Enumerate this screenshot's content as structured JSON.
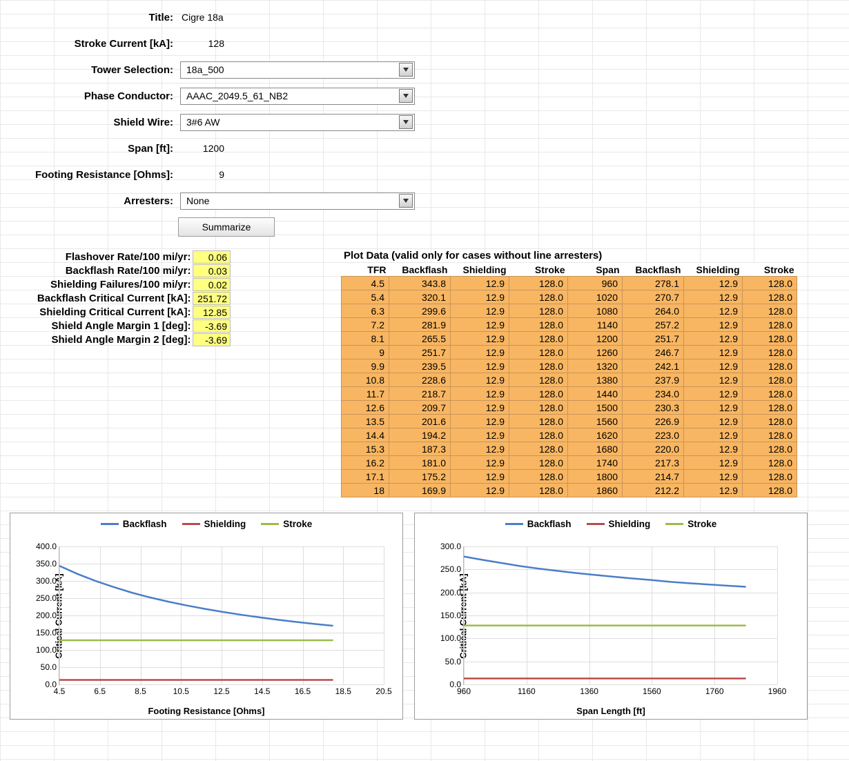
{
  "form": {
    "title_label": "Title:",
    "title_value": "Cigre 18a",
    "stroke_current_label": "Stroke Current [kA]:",
    "stroke_current_value": "128",
    "tower_label": "Tower Selection:",
    "tower_value": "18a_500",
    "phase_label": "Phase Conductor:",
    "phase_value": "AAAC_2049.5_61_NB2",
    "shield_label": "Shield Wire:",
    "shield_value": "3#6 AW",
    "span_label": "Span [ft]:",
    "span_value": "1200",
    "footing_label": "Footing Resistance [Ohms]:",
    "footing_value": "9",
    "arresters_label": "Arresters:",
    "arresters_value": "None",
    "summarize_btn": "Summarize"
  },
  "results": {
    "rows": [
      {
        "label": "Flashover Rate/100 mi/yr:",
        "value": "0.06"
      },
      {
        "label": "Backflash Rate/100 mi/yr:",
        "value": "0.03"
      },
      {
        "label": "Shielding Failures/100 mi/yr:",
        "value": "0.02"
      },
      {
        "label": "Backflash Critical Current [kA]:",
        "value": "251.72"
      },
      {
        "label": "Shielding Critical Current [kA]:",
        "value": "12.85"
      },
      {
        "label": "Shield Angle Margin 1 [deg]:",
        "value": "-3.69"
      },
      {
        "label": "Shield Angle Margin 2 [deg]:",
        "value": "-3.69"
      }
    ]
  },
  "plot_table": {
    "title": "Plot Data (valid only for cases without line arresters)",
    "headers": [
      "TFR",
      "Backflash",
      "Shielding",
      "Stroke",
      "Span",
      "Backflash",
      "Shielding",
      "Stroke"
    ],
    "rows": [
      [
        "4.5",
        "343.8",
        "12.9",
        "128.0",
        "960",
        "278.1",
        "12.9",
        "128.0"
      ],
      [
        "5.4",
        "320.1",
        "12.9",
        "128.0",
        "1020",
        "270.7",
        "12.9",
        "128.0"
      ],
      [
        "6.3",
        "299.6",
        "12.9",
        "128.0",
        "1080",
        "264.0",
        "12.9",
        "128.0"
      ],
      [
        "7.2",
        "281.9",
        "12.9",
        "128.0",
        "1140",
        "257.2",
        "12.9",
        "128.0"
      ],
      [
        "8.1",
        "265.5",
        "12.9",
        "128.0",
        "1200",
        "251.7",
        "12.9",
        "128.0"
      ],
      [
        "9",
        "251.7",
        "12.9",
        "128.0",
        "1260",
        "246.7",
        "12.9",
        "128.0"
      ],
      [
        "9.9",
        "239.5",
        "12.9",
        "128.0",
        "1320",
        "242.1",
        "12.9",
        "128.0"
      ],
      [
        "10.8",
        "228.6",
        "12.9",
        "128.0",
        "1380",
        "237.9",
        "12.9",
        "128.0"
      ],
      [
        "11.7",
        "218.7",
        "12.9",
        "128.0",
        "1440",
        "234.0",
        "12.9",
        "128.0"
      ],
      [
        "12.6",
        "209.7",
        "12.9",
        "128.0",
        "1500",
        "230.3",
        "12.9",
        "128.0"
      ],
      [
        "13.5",
        "201.6",
        "12.9",
        "128.0",
        "1560",
        "226.9",
        "12.9",
        "128.0"
      ],
      [
        "14.4",
        "194.2",
        "12.9",
        "128.0",
        "1620",
        "223.0",
        "12.9",
        "128.0"
      ],
      [
        "15.3",
        "187.3",
        "12.9",
        "128.0",
        "1680",
        "220.0",
        "12.9",
        "128.0"
      ],
      [
        "16.2",
        "181.0",
        "12.9",
        "128.0",
        "1740",
        "217.3",
        "12.9",
        "128.0"
      ],
      [
        "17.1",
        "175.2",
        "12.9",
        "128.0",
        "1800",
        "214.7",
        "12.9",
        "128.0"
      ],
      [
        "18",
        "169.9",
        "12.9",
        "128.0",
        "1860",
        "212.2",
        "12.9",
        "128.0"
      ]
    ]
  },
  "legend": {
    "backflash": "Backflash",
    "shielding": "Shielding",
    "stroke": "Stroke"
  },
  "colors": {
    "backflash": "#4a7ec8",
    "shielding": "#b84b4b",
    "stroke": "#9cb949"
  },
  "chart_data": [
    {
      "type": "line",
      "title": "",
      "xlabel": "Footing Resistance [Ohms]",
      "ylabel": "Critical Current [kA]",
      "xlim": [
        4.5,
        20.5
      ],
      "ylim": [
        0,
        400
      ],
      "xticks": [
        4.5,
        6.5,
        8.5,
        10.5,
        12.5,
        14.5,
        16.5,
        18.5,
        20.5
      ],
      "yticks": [
        0,
        50,
        100,
        150,
        200,
        250,
        300,
        350,
        400
      ],
      "x": [
        4.5,
        5.4,
        6.3,
        7.2,
        8.1,
        9,
        9.9,
        10.8,
        11.7,
        12.6,
        13.5,
        14.4,
        15.3,
        16.2,
        17.1,
        18
      ],
      "series": [
        {
          "name": "Backflash",
          "values": [
            343.8,
            320.1,
            299.6,
            281.9,
            265.5,
            251.7,
            239.5,
            228.6,
            218.7,
            209.7,
            201.6,
            194.2,
            187.3,
            181.0,
            175.2,
            169.9
          ]
        },
        {
          "name": "Shielding",
          "values": [
            12.9,
            12.9,
            12.9,
            12.9,
            12.9,
            12.9,
            12.9,
            12.9,
            12.9,
            12.9,
            12.9,
            12.9,
            12.9,
            12.9,
            12.9,
            12.9
          ]
        },
        {
          "name": "Stroke",
          "values": [
            128,
            128,
            128,
            128,
            128,
            128,
            128,
            128,
            128,
            128,
            128,
            128,
            128,
            128,
            128,
            128
          ]
        }
      ]
    },
    {
      "type": "line",
      "title": "",
      "xlabel": "Span Length [ft]",
      "ylabel": "Critical Current [kA]",
      "xlim": [
        960,
        1960
      ],
      "ylim": [
        0,
        300
      ],
      "xticks": [
        960,
        1160,
        1360,
        1560,
        1760,
        1960
      ],
      "yticks": [
        0,
        50,
        100,
        150,
        200,
        250,
        300
      ],
      "x": [
        960,
        1020,
        1080,
        1140,
        1200,
        1260,
        1320,
        1380,
        1440,
        1500,
        1560,
        1620,
        1680,
        1740,
        1800,
        1860
      ],
      "series": [
        {
          "name": "Backflash",
          "values": [
            278.1,
            270.7,
            264.0,
            257.2,
            251.7,
            246.7,
            242.1,
            237.9,
            234.0,
            230.3,
            226.9,
            223.0,
            220.0,
            217.3,
            214.7,
            212.2
          ]
        },
        {
          "name": "Shielding",
          "values": [
            12.9,
            12.9,
            12.9,
            12.9,
            12.9,
            12.9,
            12.9,
            12.9,
            12.9,
            12.9,
            12.9,
            12.9,
            12.9,
            12.9,
            12.9,
            12.9
          ]
        },
        {
          "name": "Stroke",
          "values": [
            128,
            128,
            128,
            128,
            128,
            128,
            128,
            128,
            128,
            128,
            128,
            128,
            128,
            128,
            128,
            128
          ]
        }
      ]
    }
  ]
}
